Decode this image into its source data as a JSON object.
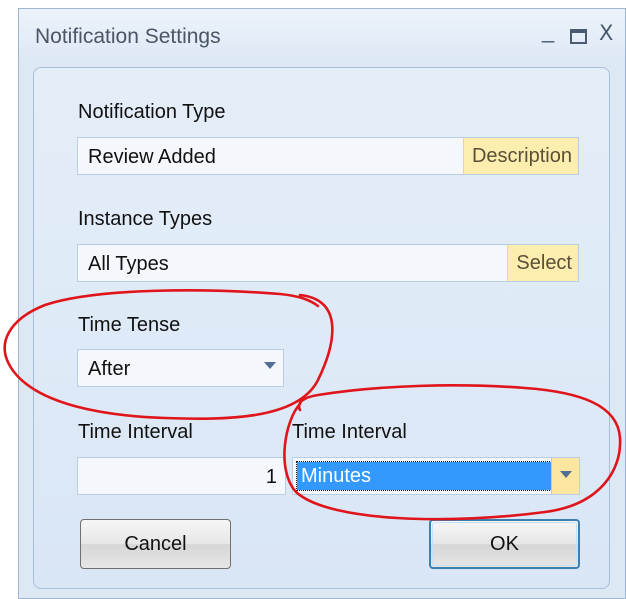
{
  "window": {
    "title": "Notification Settings",
    "controls": {
      "minimize": "_",
      "close": "X"
    }
  },
  "form": {
    "notification_type": {
      "label": "Notification Type",
      "value": "Review Added",
      "button": "Description"
    },
    "instance_types": {
      "label": "Instance Types",
      "value": "All Types",
      "button": "Select"
    },
    "time_tense": {
      "label": "Time Tense",
      "value": "After"
    },
    "time_interval_number": {
      "label": "Time Interval",
      "value": "1"
    },
    "time_interval_unit": {
      "label": "Time Interval",
      "value": "Minutes"
    }
  },
  "buttons": {
    "cancel": "Cancel",
    "ok": "OK"
  },
  "annotation": {
    "color": "#e0141b"
  }
}
